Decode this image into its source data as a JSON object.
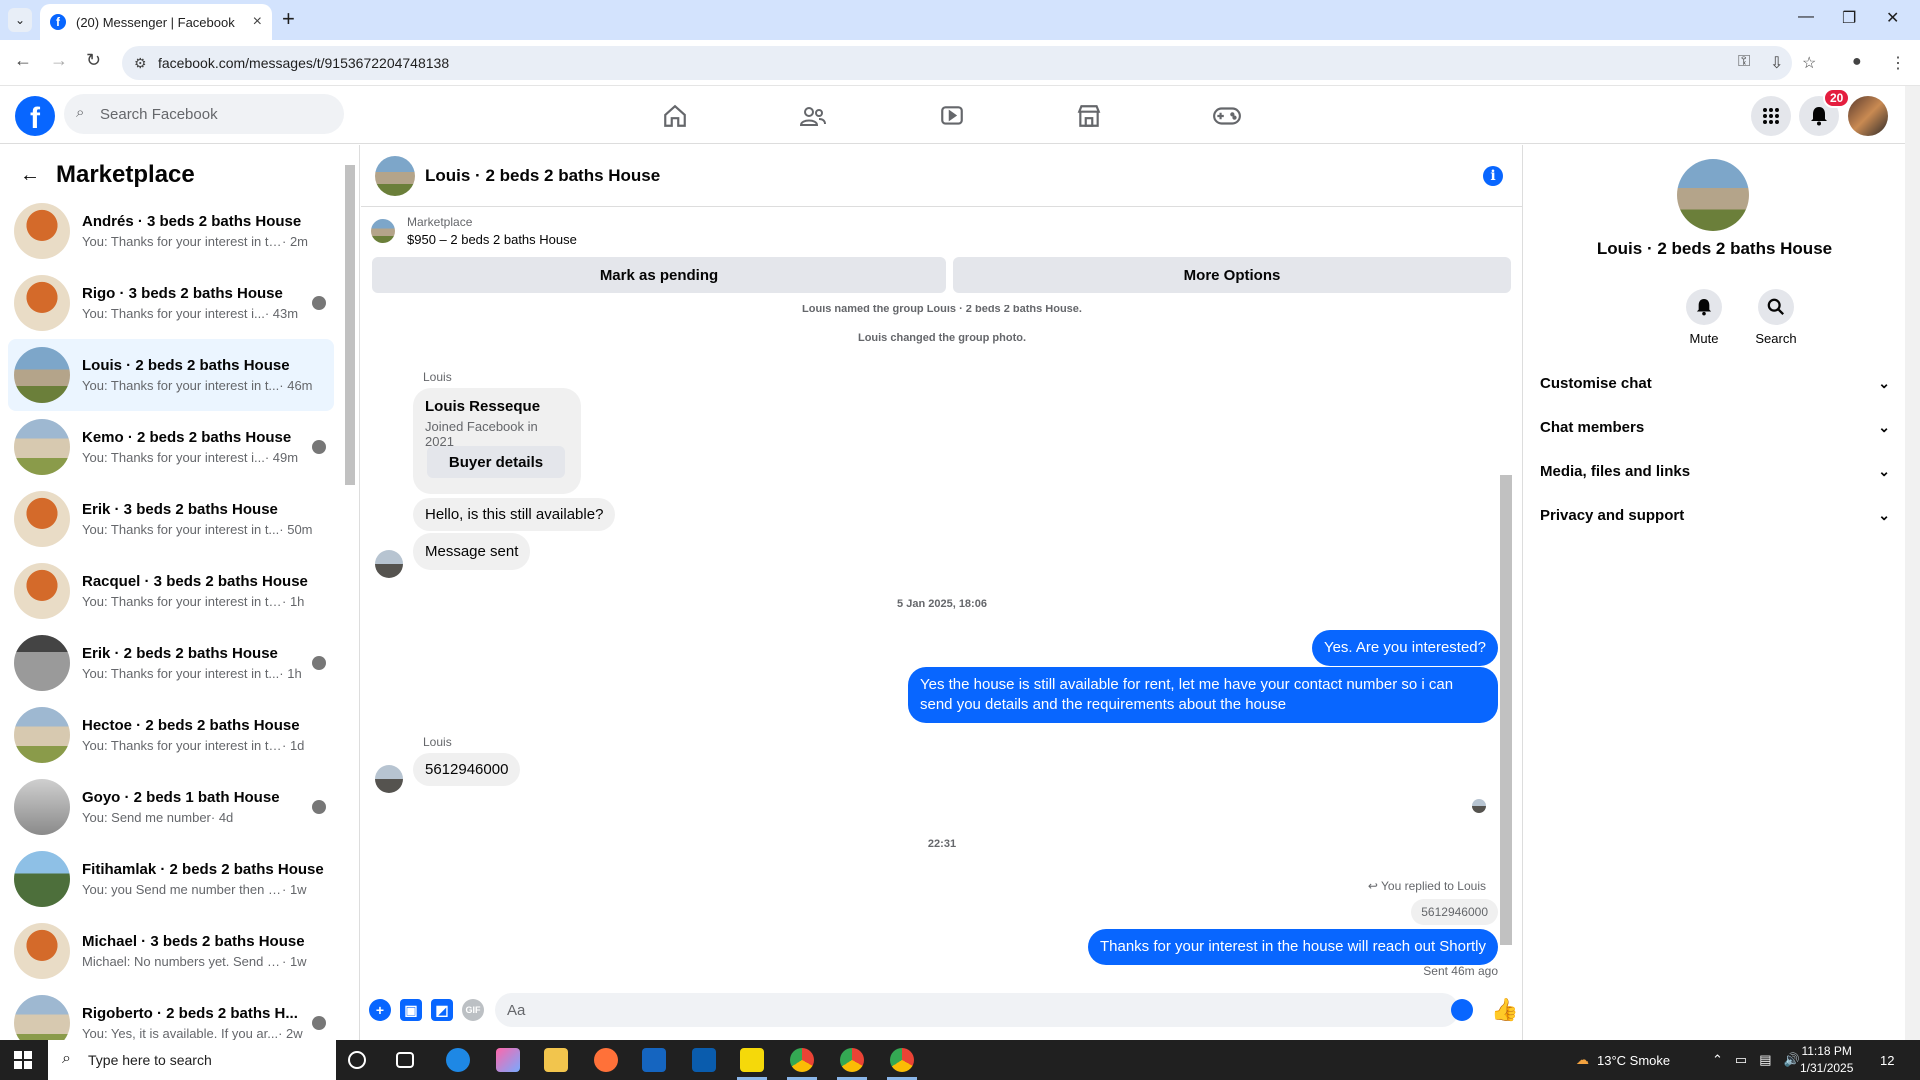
{
  "browser": {
    "tab_title": "(20) Messenger | Facebook",
    "url": "facebook.com/messages/t/9153672204748138",
    "new_tab": "+",
    "tab_close": "×"
  },
  "facebook": {
    "search_placeholder": "Search Facebook",
    "notification_count": "20"
  },
  "left_panel": {
    "title": "Marketplace",
    "conversations": [
      {
        "name": "Andrés · 3 beds 2 baths House",
        "snippet": "You: Thanks for your interest in th...",
        "time": " · 2m"
      },
      {
        "name": "Rigo · 3 beds 2 baths House",
        "snippet": "You: Thanks for your interest i...",
        "time": " · 43m"
      },
      {
        "name": "Louis · 2 beds 2 baths House",
        "snippet": "You: Thanks for your interest in t...",
        "time": " · 46m"
      },
      {
        "name": "Kemo · 2 beds 2 baths House",
        "snippet": "You: Thanks for your interest i...",
        "time": " · 49m"
      },
      {
        "name": "Erik · 3 beds 2 baths House",
        "snippet": "You: Thanks for your interest in t...",
        "time": " · 50m"
      },
      {
        "name": "Racquel · 3 beds 2 baths House",
        "snippet": "You: Thanks for your interest in the...",
        "time": " · 1h"
      },
      {
        "name": "Erik · 2 beds 2 baths House",
        "snippet": "You: Thanks for your interest in t...",
        "time": " · 1h"
      },
      {
        "name": "Hectoe · 2 beds 2 baths House",
        "snippet": "You: Thanks for your interest in the...",
        "time": " · 1d"
      },
      {
        "name": "Goyo · 2 beds 1 bath House",
        "snippet": "You: Send me number",
        "time": " · 4d"
      },
      {
        "name": "Fitihamlak · 2 beds 2 baths House",
        "snippet": "You: you Send me number then I ...",
        "time": " · 1w"
      },
      {
        "name": "Michael · 3 beds 2 baths House",
        "snippet": "Michael: No numbers yet. Send m...",
        "time": " · 1w"
      },
      {
        "name": "Rigoberto · 2 beds 2 baths H...",
        "snippet": "You: Yes, it is available. If you ar...",
        "time": " · 2w"
      }
    ]
  },
  "chat": {
    "title": "Louis · 2 beds 2 baths House",
    "listing_source": "Marketplace",
    "listing_price": "$950 – 2 beds 2 baths House",
    "mark_pending": "Mark as pending",
    "more_options": "More Options",
    "sys1": "Louis named the group Louis · 2 beds 2 baths House.",
    "sys2": "Louis changed the group photo.",
    "sender_louis": "Louis",
    "card_name": "Louis Resseque",
    "card_joined": "Joined Facebook in 2021",
    "card_button": "Buyer details",
    "msg_in1": "Hello, is this still available?",
    "msg_in2": "Message sent",
    "date1": "5 Jan 2025, 18:06",
    "msg_out1": "Yes. Are you interested?",
    "msg_out2": "Yes the house is still available for rent, let me have your contact number so i can send you details and the requirements about the house",
    "sender_louis2": "Louis",
    "msg_in3": "5612946000",
    "date2": "22:31",
    "replied_label": "You replied to Louis",
    "reply_quote": "5612946000",
    "msg_out3": "Thanks for your interest in the house will reach out Shortly",
    "sent_meta": "Sent 46m ago",
    "composer_placeholder": "Aa",
    "gif_label": "GIF"
  },
  "right_panel": {
    "title": "Louis · 2 beds 2 baths House",
    "mute": "Mute",
    "search": "Search",
    "sections": [
      "Customise chat",
      "Chat members",
      "Media, files and links",
      "Privacy and support"
    ]
  },
  "taskbar": {
    "search_placeholder": "Type here to search",
    "weather": "13°C  Smoke",
    "time": "11:18 PM",
    "date": "1/31/2025",
    "notif_count": "12"
  },
  "colors": {
    "fb_blue": "#0866ff",
    "active_conv": "#ebf5ff",
    "badge_red": "#e41e3f"
  }
}
